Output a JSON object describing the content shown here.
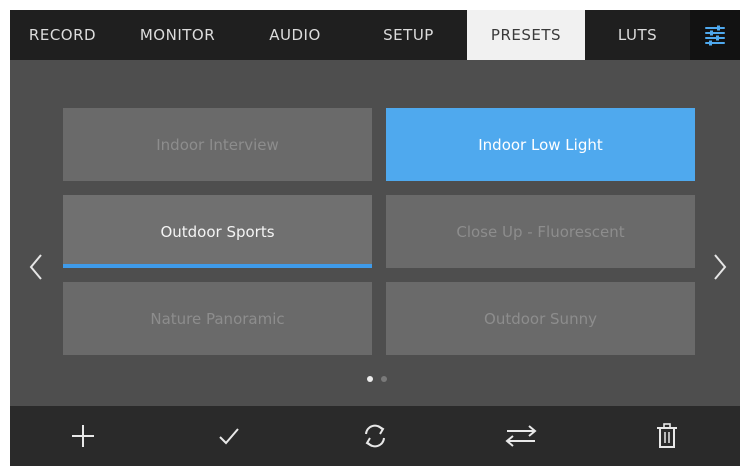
{
  "tabs": [
    {
      "label": "RECORD",
      "active": false
    },
    {
      "label": "MONITOR",
      "active": false
    },
    {
      "label": "AUDIO",
      "active": false
    },
    {
      "label": "SETUP",
      "active": false
    },
    {
      "label": "PRESETS",
      "active": true
    },
    {
      "label": "LUTS",
      "active": false
    }
  ],
  "tab_icon": "sliders-icon",
  "presets": [
    {
      "label": "Indoor Interview",
      "state": "inactive"
    },
    {
      "label": "Indoor Low Light",
      "state": "selected"
    },
    {
      "label": "Outdoor Sports",
      "state": "current"
    },
    {
      "label": "Close Up - Fluorescent",
      "state": "inactive"
    },
    {
      "label": "Nature Panoramic",
      "state": "inactive"
    },
    {
      "label": "Outdoor Sunny",
      "state": "inactive"
    }
  ],
  "pagination": {
    "current_page": 1,
    "total_pages": 2
  },
  "nav": {
    "prev_icon": "chevron-left-icon",
    "next_icon": "chevron-right-icon"
  },
  "toolbar": [
    {
      "name": "add",
      "icon": "plus-icon"
    },
    {
      "name": "apply",
      "icon": "checkmark-icon"
    },
    {
      "name": "update",
      "icon": "refresh-icon"
    },
    {
      "name": "import-export",
      "icon": "swap-arrows-icon"
    },
    {
      "name": "delete",
      "icon": "trash-icon"
    }
  ],
  "colors": {
    "accent": "#4fa9ee",
    "tab_active_bg": "#f1f1f1",
    "tabbar_bg": "#1f1f1f",
    "panel_bg": "#4e4e4e",
    "toolbar_bg": "#2a2a2a"
  }
}
